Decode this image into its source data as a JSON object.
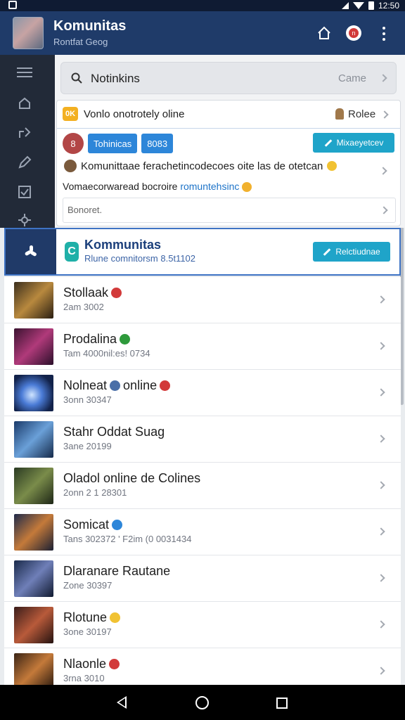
{
  "status_bar": {
    "time": "12:50"
  },
  "header": {
    "title": "Komunitas",
    "subtitle": "Rontfat Geog"
  },
  "search": {
    "query": "Notinkins",
    "right_label": "Came"
  },
  "card": {
    "row1_badge": "0K",
    "row1_text": "Vonlo onotrotely oline",
    "row1_right": "Rolee",
    "avatar_letter": "8",
    "chips": [
      "Tohinicas",
      "8083"
    ],
    "message_button": "Mixaeyetcev",
    "line1": "Komunittaae ferachetincodecoes oite las de otetcan",
    "line2_text": "Vomaecorwaread bocroire",
    "line2_link": "romuntehsinc",
    "comment_placeholder": "Bonoret."
  },
  "highlight": {
    "title": "Kommunitas",
    "subtitle": "Rlune comnitorsm 8.5t1102",
    "button": "Relctiudnae"
  },
  "list": [
    {
      "name": "Stollaak",
      "sub": "2am 3002",
      "badge_color": "#d23a3a",
      "thumb": "linear-gradient(135deg,#3b2f1d,#b8893e 50%,#2a1e12)"
    },
    {
      "name": "Prodalina",
      "sub": "Tam 4000nil:es! 0734",
      "badge_color": "#2e9a3b",
      "thumb": "linear-gradient(135deg,#3a1230,#b03a7a 50%,#2b0f2a)"
    },
    {
      "name": "Nolneat",
      "sub": "3onn 30347",
      "extra": "online",
      "badge_color": "#d23a3a",
      "thumb": "radial-gradient(circle at 45% 55%,#cfe4ff,#4a7bd6 35%,#12224a 75%)"
    },
    {
      "name": "Stahr Oddat Suag",
      "sub": "3ane 20199",
      "badge_color": "",
      "thumb": "linear-gradient(135deg,#1a3a6a,#6aa0d8 50%,#152a4a)"
    },
    {
      "name": "Oladol online de Colines",
      "sub": "2onn 2 1 28301",
      "badge_color": "",
      "thumb": "linear-gradient(135deg,#2a3a22,#7a8c4a 50%,#1d2616)"
    },
    {
      "name": "Somicat",
      "sub": "Tans 302372 ' F2im (0 0031434",
      "badge_color": "#2d86d9",
      "thumb": "linear-gradient(135deg,#1e2a4a,#c47a3a 50%,#1a1f33)"
    },
    {
      "name": "Dlaranare Rautane",
      "sub": "Zone 30397",
      "badge_color": "",
      "thumb": "linear-gradient(135deg,#1a2a4a,#6f7fb8 50%,#101a30)"
    },
    {
      "name": "Rlotune",
      "sub": "3one 30197",
      "badge_color": "#f1c232",
      "thumb": "linear-gradient(135deg,#3a1d1a,#b85a3a 50%,#241210)"
    },
    {
      "name": "Nlaonle",
      "sub": "3rna 3010",
      "badge_color": "#d23a3a",
      "thumb": "linear-gradient(135deg,#3a2415,#c47a3a 50%,#22140c)"
    }
  ]
}
